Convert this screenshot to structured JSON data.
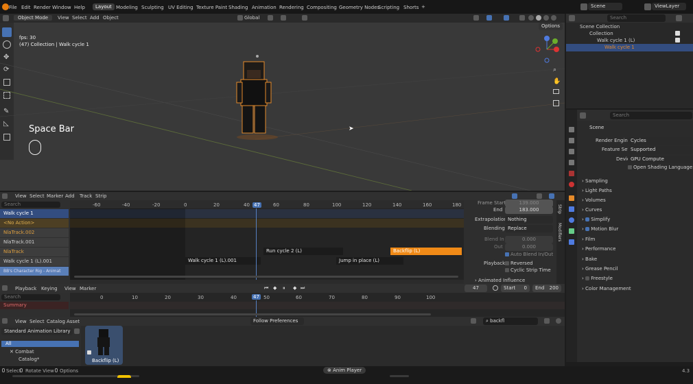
{
  "menubar": {
    "menus": [
      "File",
      "Edit",
      "Render",
      "Window",
      "Help"
    ],
    "workspaces": [
      "Layout",
      "Modeling",
      "Sculpting",
      "UV Editing",
      "Texture Paint",
      "Shading",
      "Animation",
      "Rendering",
      "Compositing",
      "Geometry Nodes",
      "Scripting",
      "Shorts"
    ],
    "active_workspace": "Layout",
    "add_tab": "+",
    "scene": "Scene",
    "view_layer": "ViewLayer"
  },
  "viewport": {
    "mode": "Object Mode",
    "menus": [
      "View",
      "Select",
      "Add",
      "Object"
    ],
    "transform": "Global",
    "options": "Options",
    "info_fps": "fps: 30",
    "info_collection": "(47) Collection | Walk cycle 1",
    "overlay_key": "Space Bar"
  },
  "outliner": {
    "search_placeholder": "Search",
    "items": [
      "Scene Collection",
      "Collection",
      "Walk cycle 1 (L)",
      "Walk cycle 1"
    ]
  },
  "properties": {
    "search_placeholder": "Search",
    "title": "Scene",
    "render_engine_label": "Render Engine",
    "render_engine": "Cycles",
    "feature_set_label": "Feature Set",
    "feature_set": "Supported",
    "device_label": "Device",
    "device": "GPU Compute",
    "osl_label": "Open Shading Language",
    "sections": [
      "Sampling",
      "Light Paths",
      "Volumes",
      "Curves",
      "Simplify",
      "Motion Blur",
      "Film",
      "Performance",
      "Bake",
      "Grease Pencil",
      "Freestyle",
      "Color Management"
    ]
  },
  "nla": {
    "menus": [
      "View",
      "Select",
      "Marker",
      "Add",
      "Track",
      "Strip"
    ],
    "search_placeholder": "Search",
    "ruler": [
      "-60",
      "-40",
      "-20",
      "0",
      "20",
      "40",
      "60",
      "80",
      "100",
      "120",
      "140",
      "160",
      "180"
    ],
    "current_frame": "47",
    "tracks": [
      "Walk cycle 1",
      "<No Action>",
      "NlaTrack.002",
      "NlaTrack.001",
      "NlaTrack",
      "Walk cycle 1 (L).001",
      "BB's Character Rig - Animat"
    ],
    "strips": [
      "Walk cycle 1 (L).001",
      "Run cycle 2 (L)",
      "Jump in place (L)",
      "Backflip (L)"
    ],
    "sidebar": {
      "frame_start_label": "Frame Start",
      "frame_start": "139.000",
      "end_label": "End",
      "end": "183.000",
      "extrapolation_label": "Extrapolation",
      "extrapolation": "Nothing",
      "blending_label": "Blending",
      "blending": "Replace",
      "blend_in_label": "Blend In",
      "blend_in": "0.000",
      "out_label": "Out",
      "out": "0.000",
      "auto_blend": "Auto Blend In/Out",
      "playback_label": "Playback",
      "reversed": "Reversed",
      "cyclic": "Cyclic Strip Time",
      "animated_influence": "Animated Influence"
    },
    "side_tabs": [
      "Strip",
      "Modifiers"
    ]
  },
  "timeline": {
    "menus": [
      "Playback",
      "Keying",
      "View",
      "Marker"
    ],
    "search_placeholder": "Search",
    "summary": "Summary",
    "current_frame": "47",
    "start_label": "Start",
    "start": "0",
    "end_label": "End",
    "end": "200",
    "ruler": [
      "0",
      "10",
      "20",
      "30",
      "40",
      "47",
      "50",
      "60",
      "70",
      "80",
      "90",
      "100"
    ]
  },
  "asset_browser": {
    "menus": [
      "View",
      "Select",
      "Catalog",
      "Asset"
    ],
    "library": "Standard Animation Library",
    "follow": "Follow Preferences",
    "search_value": "backfl",
    "tree": [
      "All",
      "Combat",
      "Catalog*"
    ],
    "asset_name": "Backflip (L)"
  },
  "statusbar": {
    "select": "Select",
    "rotate": "Rotate View",
    "options": "Options",
    "anim_player": "Anim Player",
    "version": "4.3"
  },
  "colors": {
    "accent": "#4772b3",
    "selected_strip": "#f08a17",
    "object_outline": "#e58a2a",
    "playhead": "#5680c2"
  }
}
